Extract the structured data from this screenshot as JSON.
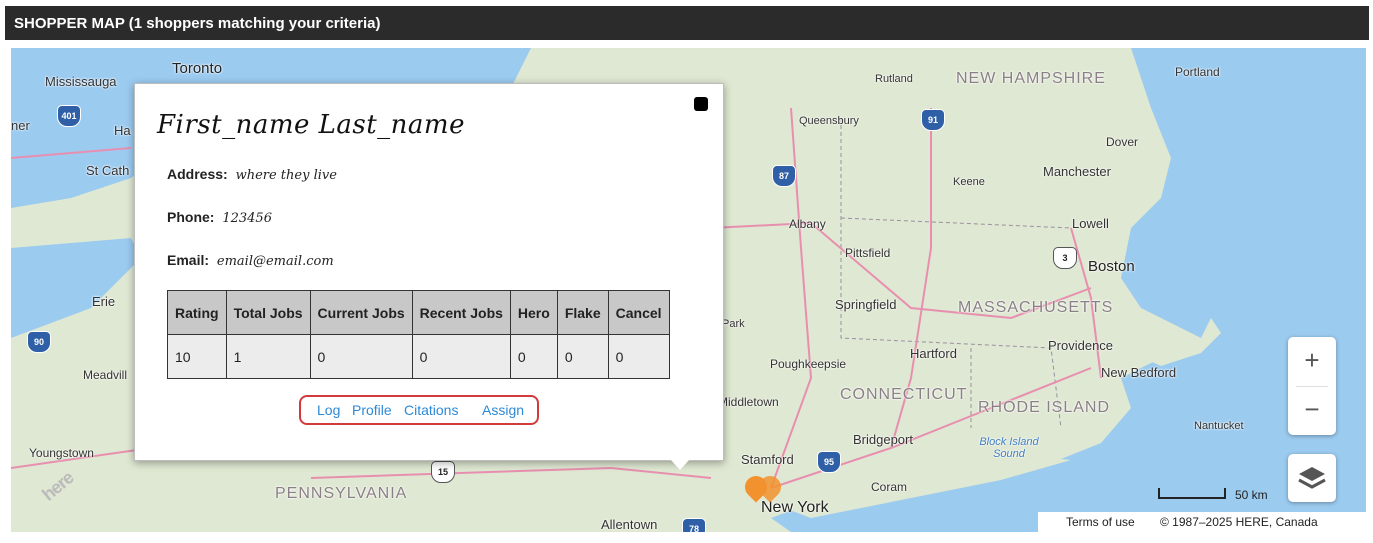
{
  "header": {
    "title": "SHOPPER MAP (1 shoppers matching your criteria)"
  },
  "map": {
    "places": [
      {
        "name": "Toronto"
      },
      {
        "name": "Mississauga"
      },
      {
        "name": "St Cath"
      },
      {
        "name": "Erie"
      },
      {
        "name": "Meadvill"
      },
      {
        "name": "Youngstown"
      },
      {
        "name": "PENNSYLVANIA"
      },
      {
        "name": "Allentown"
      },
      {
        "name": "New York"
      },
      {
        "name": "Stamford"
      },
      {
        "name": "Bridgeport"
      },
      {
        "name": "Coram"
      },
      {
        "name": "Hartford"
      },
      {
        "name": "Poughkeepsie"
      },
      {
        "name": "Middletown"
      },
      {
        "name": "CONNECTICUT"
      },
      {
        "name": "RHODE ISLAND"
      },
      {
        "name": "Providence"
      },
      {
        "name": "New Bedford"
      },
      {
        "name": "Nantucket"
      },
      {
        "name": "Block Island Sound"
      },
      {
        "name": "Springfield"
      },
      {
        "name": "MASSACHUSETTS"
      },
      {
        "name": "Pittsfield"
      },
      {
        "name": "Albany"
      },
      {
        "name": "Queensbury"
      },
      {
        "name": "Rutland"
      },
      {
        "name": "NEW HAMPSHIRE"
      },
      {
        "name": "Portland"
      },
      {
        "name": "Dover"
      },
      {
        "name": "Manchester"
      },
      {
        "name": "Keene"
      },
      {
        "name": "Lowell"
      },
      {
        "name": "Boston"
      },
      {
        "name": "Park"
      },
      {
        "name": "ner"
      },
      {
        "name": "Ha"
      }
    ],
    "highway_shields": [
      "401",
      "90",
      "87",
      "91",
      "95",
      "15",
      "78",
      "3"
    ],
    "zoom_in_label": "+",
    "zoom_out_label": "−",
    "scale_label": "50 km",
    "terms_label": "Terms of use",
    "copyright": "© 1987–2025 HERE, Canada",
    "logo_text": "here",
    "marker_color": "#f2922e"
  },
  "popup": {
    "name": "First_name Last_name",
    "address_label": "Address:",
    "address_value": "where they live",
    "phone_label": "Phone:",
    "phone_value": "123456",
    "email_label": "Email:",
    "email_value": "email@email.com",
    "table": {
      "headers": [
        "Rating",
        "Total Jobs",
        "Current Jobs",
        "Recent Jobs",
        "Hero",
        "Flake",
        "Cancel"
      ],
      "row": [
        "10",
        "1",
        "0",
        "0",
        "0",
        "0",
        "0"
      ]
    },
    "actions": {
      "log": "Log",
      "profile": "Profile",
      "citations": "Citations",
      "assign": "Assign"
    }
  },
  "colors": {
    "header_bg": "#2b2b2b",
    "link": "#2c8ad6",
    "action_border": "#d23b3b",
    "water": "#9ccbf0",
    "land": "#dfe8d2",
    "roads": "#e88fb0"
  }
}
